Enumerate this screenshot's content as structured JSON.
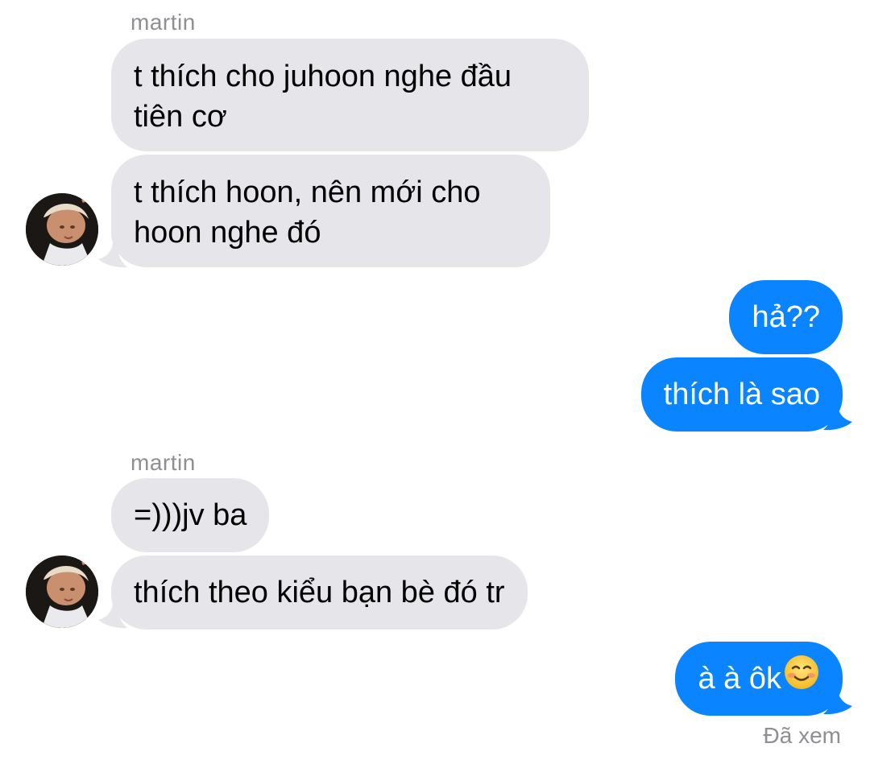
{
  "thread": {
    "group1_sender": "martin",
    "group1_msg1_line1": "t thích cho juhoon nghe đầu",
    "group1_msg1_line2": "tiên cơ",
    "group1_msg2_line1": "t thích hoon, nên mới cho",
    "group1_msg2_line2": "hoon nghe đó",
    "out1_msg1": "hả??",
    "out1_msg2": "thích là sao",
    "group2_sender": "martin",
    "group2_msg1": "=)))jv ba",
    "group2_msg2": "thích theo kiểu bạn bè đó tr",
    "out2_msg1": "à à ôk",
    "out2_emoji": "smiling-face-emoji",
    "read_receipt": "Đã xem"
  },
  "colors": {
    "incoming_bubble": "#e5e5ea",
    "outgoing_bubble": "#0a84ff",
    "meta_text": "#8e8e93"
  },
  "icons": {
    "avatar": "contact-avatar-photo"
  }
}
